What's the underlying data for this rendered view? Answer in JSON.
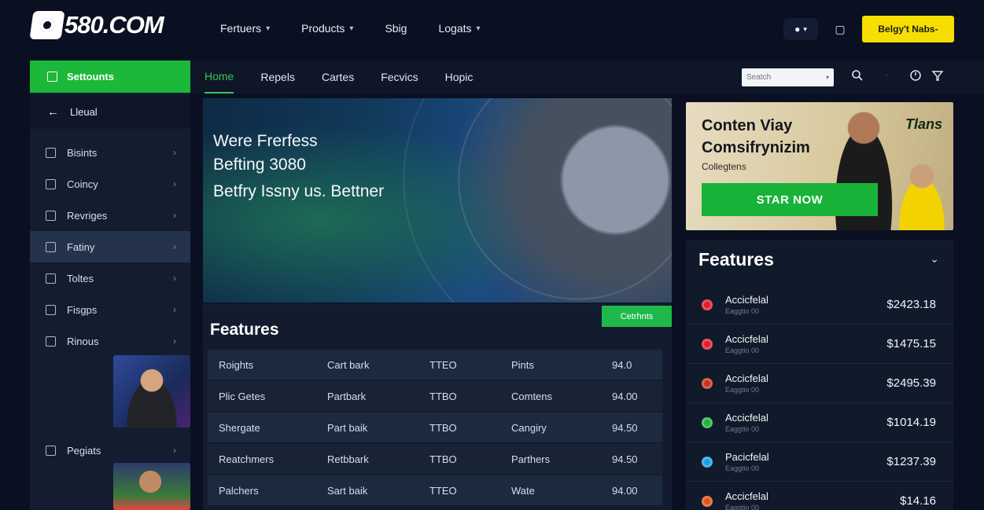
{
  "header": {
    "logo_text": "580.COM",
    "nav": [
      "Fertuers",
      "Products",
      "Sbig",
      "Logats"
    ],
    "cta_label": "Belgy't Nabs-"
  },
  "sidebar": {
    "top_label": "Settounts",
    "back_label": "Lleual",
    "items": [
      "Bisints",
      "Coincy",
      "Revriges",
      "Fatiny",
      "Toltes",
      "Fisgps",
      "Rinous"
    ],
    "bottom_item": "Pegiats"
  },
  "mainnav": {
    "tabs": [
      "Home",
      "Repels",
      "Cartes",
      "Fecvics",
      "Hopic"
    ],
    "search_placeholder": "Seatch"
  },
  "hero": {
    "line1": "Were Frerfess",
    "line2": "Befting 3080",
    "line3": "Betfry Issny us. Bettner"
  },
  "features": {
    "title": "Features",
    "button_label": "Cetrhnts",
    "rows": [
      [
        "Roights",
        "Cart bark",
        "TTEO",
        "Pints",
        "94.0"
      ],
      [
        "Plic Getes",
        "Partbark",
        "TTBO",
        "Comtens",
        "94.00"
      ],
      [
        "Shergate",
        "Part baik",
        "TTBO",
        "Cangiry",
        "94.50"
      ],
      [
        "Reatchmers",
        "Retbbark",
        "TTBO",
        "Parthers",
        "94.50"
      ],
      [
        "Palchers",
        "Sart baik",
        "TTEO",
        "Wate",
        "94.00"
      ]
    ]
  },
  "promo": {
    "title_line1": "Conten Viay",
    "title_line2": "Comsifrynizim",
    "subtitle": "Collegtens",
    "cta_label": "STAR NOW",
    "brand": "Tlans"
  },
  "right_panel": {
    "title": "Features",
    "items": [
      {
        "name": "Accicfelal",
        "sub": "Eaggtio 00",
        "amount": "$2423.18",
        "color": "#e11d2a"
      },
      {
        "name": "Accicfelal",
        "sub": "Eaggtio 00",
        "amount": "$1475.15",
        "color": "#e11d2a"
      },
      {
        "name": "Accicfelal",
        "sub": "Eaggtio 00",
        "amount": "$2495.39",
        "color": "#c9331d"
      },
      {
        "name": "Accicfelal",
        "sub": "Eaggtio 00",
        "amount": "$1014.19",
        "color": "#22b33b"
      },
      {
        "name": "Pacicfelal",
        "sub": "Eaggtio 00",
        "amount": "$1237.39",
        "color": "#1a9ee6"
      },
      {
        "name": "Accicfelal",
        "sub": "Eaggtio 00",
        "amount": "$14.16",
        "color": "#e0531b"
      }
    ]
  },
  "colors": {
    "accent_green": "#1bb83a",
    "cta_yellow": "#f6df00",
    "background": "#0a1022"
  }
}
